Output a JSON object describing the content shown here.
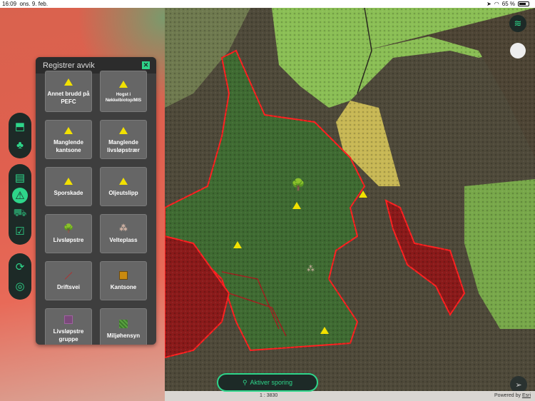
{
  "status_bar": {
    "time": "16:09",
    "date": "ons. 9. feb.",
    "battery": "65 %",
    "battery_level": 0.65
  },
  "panel": {
    "title": "Registrer avvik",
    "items": [
      {
        "label": "Annet brudd på PEFC",
        "icon": "warning-icon"
      },
      {
        "label": "Hogst i Nøkkelbiotop/MIS",
        "icon": "warning-icon"
      },
      {
        "label": "Manglende kantsone",
        "icon": "warning-icon"
      },
      {
        "label": "Manglende livsløpstrær",
        "icon": "warning-icon"
      },
      {
        "label": "Sporskade",
        "icon": "warning-icon"
      },
      {
        "label": "Oljeutslipp",
        "icon": "oil-warning-icon"
      },
      {
        "label": "Livsløpstre",
        "icon": "tree-icon"
      },
      {
        "label": "Velteplass",
        "icon": "log-pile-icon"
      },
      {
        "label": "Driftsvei",
        "icon": "line-icon"
      },
      {
        "label": "Kantsone",
        "icon": "orange-square-icon"
      },
      {
        "label": "Livsløpstre gruppe",
        "icon": "purple-square-icon"
      },
      {
        "label": "Miljøhensyn",
        "icon": "green-hatch-icon"
      }
    ]
  },
  "track_button": {
    "label": "Aktiver sporing"
  },
  "scale": "1 : 3830",
  "attribution": {
    "prefix": "Powered by",
    "link": "Esri"
  },
  "colors": {
    "accent": "#2ed58a",
    "toolbar": "#1d2a27",
    "panel": "#3e3e3e"
  }
}
